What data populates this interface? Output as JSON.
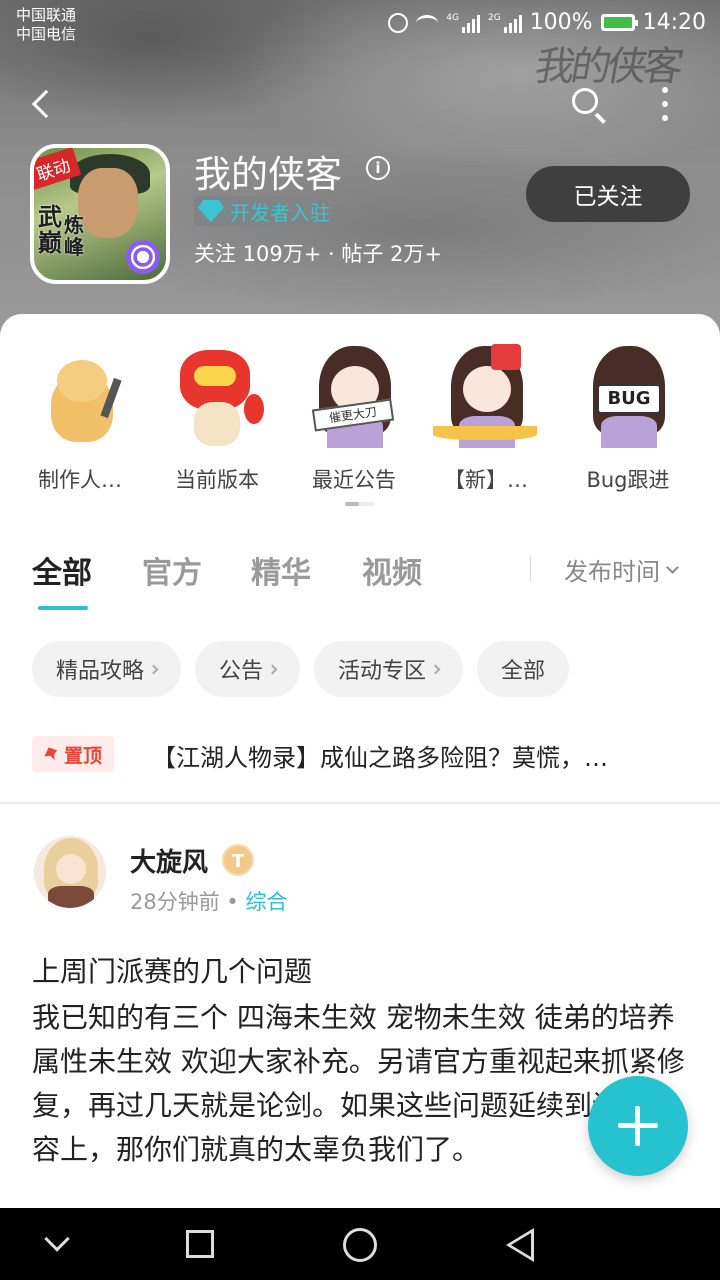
{
  "status_bar": {
    "carrier1": "中国联通",
    "carrier2": "中国电信",
    "net1": "4G",
    "net2": "2G",
    "battery": "100%",
    "time": "14:20"
  },
  "header": {
    "game_title": "我的侠客",
    "dev_badge": "开发者入驻",
    "stats": "关注 109万+ · 帖子 2万+",
    "follow_button": "已关注",
    "icon_tag": "联动",
    "icon_text1": "武巅",
    "icon_text2": "炼峰"
  },
  "quick_entries": [
    {
      "label": "制作人…",
      "image": "shiba-dog-hammer"
    },
    {
      "label": "当前版本",
      "image": "lion-dance-dog"
    },
    {
      "label": "最近公告",
      "image": "girl-sign",
      "sign": "催更大刀"
    },
    {
      "label": "【新】…",
      "image": "girl-red-envelope"
    },
    {
      "label": "Bug跟进",
      "image": "girl-bug-sign",
      "sign": "BUG"
    }
  ],
  "tabs": [
    {
      "label": "全部",
      "active": true
    },
    {
      "label": "官方",
      "active": false
    },
    {
      "label": "精华",
      "active": false
    },
    {
      "label": "视频",
      "active": false
    }
  ],
  "sort_label": "发布时间",
  "chips": [
    {
      "label": "精品攻略",
      "chevron": true
    },
    {
      "label": "公告",
      "chevron": true
    },
    {
      "label": "活动专区",
      "chevron": true
    },
    {
      "label": "全部",
      "chevron": false
    }
  ],
  "pinned": {
    "badge": "置顶",
    "text": "【江湖人物录】成仙之路多险阻？莫慌，…"
  },
  "post": {
    "author": "大旋风",
    "level": "T5",
    "time": "28分钟前",
    "dot": "•",
    "category": "综合",
    "title": "上周门派赛的几个问题",
    "body": "我已知的有三个 四海未生效 宠物未生效 徒弟的培养属性未生效 欢迎大家补充。另请官方重视起来抓紧修复，再过几天就是论剑。如果这些问题延续到论剑阵容上，那你们就真的太辜负我们了。"
  },
  "colors": {
    "accent": "#26c2cf",
    "pin": "#e8463b",
    "follow_bg": "#3f3f3f"
  }
}
